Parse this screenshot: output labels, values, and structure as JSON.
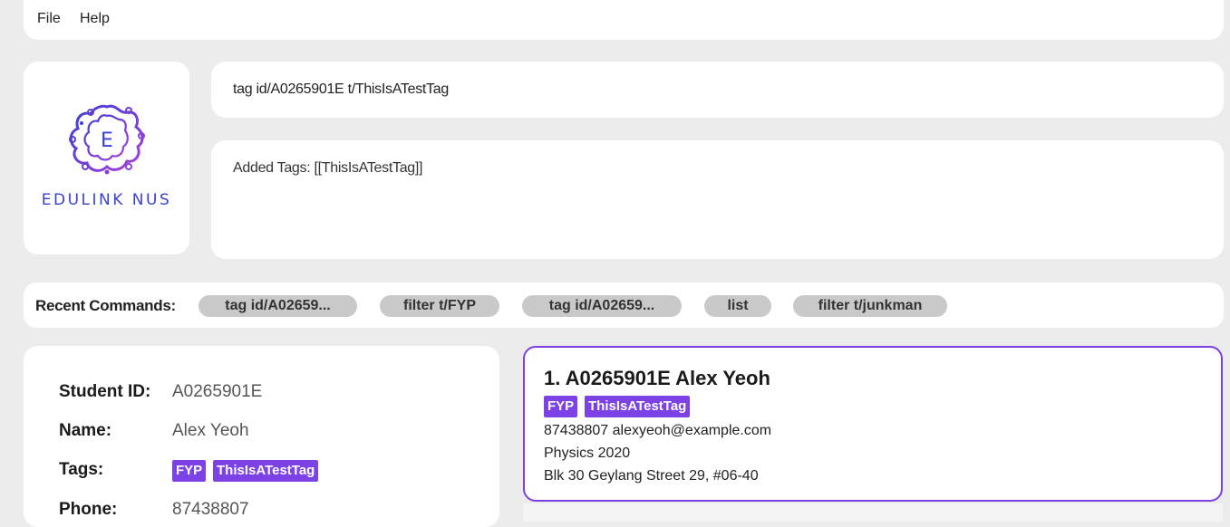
{
  "menu": {
    "file": "File",
    "help": "Help"
  },
  "logo": {
    "letter": "E",
    "text": "EDULINK NUS",
    "color": "#3a3fd4",
    "accent": "#8a3fd9"
  },
  "command": {
    "value": "tag id/A0265901E t/ThisIsATestTag",
    "placeholder": ""
  },
  "result": {
    "text": "Added Tags: [[ThisIsATestTag]]"
  },
  "recent": {
    "label": "Recent Commands:",
    "items": [
      "tag id/A02659...",
      "filter t/FYP",
      "tag id/A02659...",
      "list",
      "filter t/junkman"
    ]
  },
  "detail": {
    "labels": {
      "student_id": "Student ID:",
      "name": "Name:",
      "tags": "Tags:",
      "phone": "Phone:"
    },
    "student_id": "A0265901E",
    "name": "Alex Yeoh",
    "tags": [
      "FYP",
      "ThisIsATestTag"
    ],
    "phone": "87438807"
  },
  "person_card": {
    "title": "1.  A0265901E Alex Yeoh",
    "tags": [
      "FYP",
      "ThisIsATestTag"
    ],
    "contact": "87438807  alexyeoh@example.com",
    "major_year": "Physics  2020",
    "address": "Blk 30 Geylang Street 29, #06-40"
  },
  "colors": {
    "tag": "#7d42e6",
    "selected_border": "#7b3fe4",
    "chip": "#c9c9c9",
    "background": "#ececec"
  }
}
